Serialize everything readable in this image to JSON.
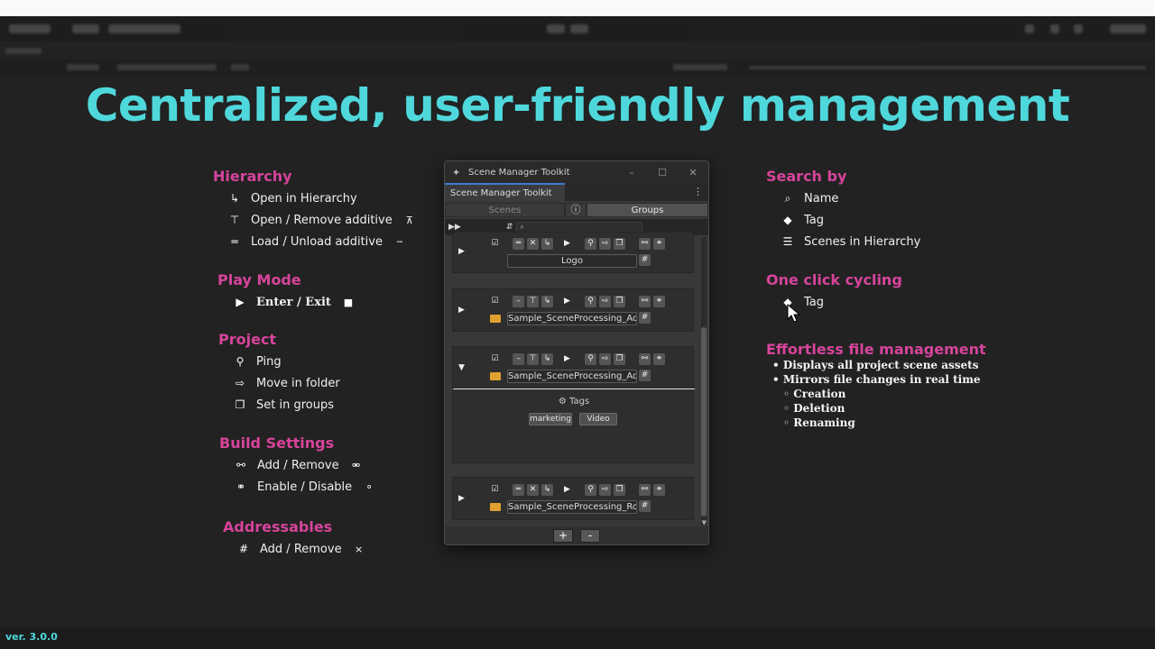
{
  "headline": "Centralized, user-friendly management",
  "left": {
    "hierarchy": {
      "title": "Hierarchy",
      "items": [
        "Open in Hierarchy",
        "Open / Remove additive",
        "Load / Unload additive"
      ]
    },
    "play_mode": {
      "title": "Play Mode",
      "item": "Enter / Exit"
    },
    "project": {
      "title": "Project",
      "items": [
        "Ping",
        "Move in folder",
        "Set in groups"
      ]
    },
    "build_settings": {
      "title": "Build Settings",
      "items": [
        "Add / Remove",
        "Enable / Disable"
      ]
    },
    "addressables": {
      "title": "Addressables",
      "items": [
        "Add / Remove"
      ]
    }
  },
  "right": {
    "search_by": {
      "title": "Search by",
      "items": [
        "Name",
        "Tag",
        "Scenes in Hierarchy"
      ]
    },
    "cycling": {
      "title": "One click cycling",
      "item": "Tag"
    },
    "file_mgmt": {
      "title": "Effortless file management",
      "bullets": [
        "• Displays all project scene assets",
        "• Mirrors file changes in real time"
      ],
      "sub_bullets": [
        "◦ Creation",
        "◦ Deletion",
        "◦ Renaming"
      ]
    }
  },
  "window": {
    "title": "Scene Manager Toolkit",
    "tab": "Scene Manager Toolkit",
    "seg_scenes": "Scenes",
    "seg_groups": "Groups",
    "cards": [
      {
        "name": "Logo"
      },
      {
        "name": "Sample_SceneProcessing_Ad..."
      },
      {
        "name": "Sample_SceneProcessing_Ad..."
      },
      {
        "name": "Sample_SceneProcessing_Root"
      }
    ],
    "tags_label": "Tags",
    "tags": [
      "marketing",
      "Video"
    ],
    "add": "+",
    "remove": "-"
  },
  "version": "ver. 3.0.0",
  "colors": {
    "headline": "#4fd8dc",
    "section": "#d6449b",
    "background": "#222222"
  }
}
